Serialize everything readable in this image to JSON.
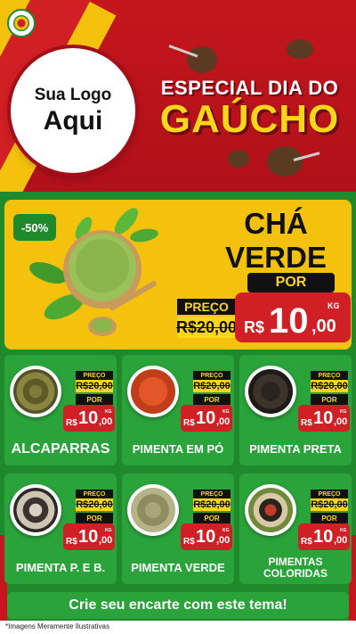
{
  "header": {
    "logo_line1": "Sua Logo",
    "logo_line2": "Aqui",
    "title_line1": "ESPECIAL DIA DO",
    "title_line2": "GAÚCHO"
  },
  "featured": {
    "discount": "-50%",
    "name_line1": "CHÁ",
    "name_line2": "VERDE",
    "por_label": "POR",
    "preco_label": "PREÇO",
    "old_price": "R$20,00",
    "currency": "R$",
    "price_int": "10",
    "price_dec": ",00",
    "unit": "KG"
  },
  "labels": {
    "preco": "PREÇO",
    "por": "POR",
    "currency": "R$",
    "unit": "KG"
  },
  "products": [
    {
      "name": "ALCAPARRAS",
      "old_price": "R$20,00",
      "price_int": "10",
      "price_dec": ",00"
    },
    {
      "name": "PIMENTA EM PÓ",
      "old_price": "R$20,00",
      "price_int": "10",
      "price_dec": ",00"
    },
    {
      "name": "PIMENTA PRETA",
      "old_price": "R$20,00",
      "price_int": "10",
      "price_dec": ",00"
    },
    {
      "name": "PIMENTA P. E B.",
      "old_price": "R$20,00",
      "price_int": "10",
      "price_dec": ",00"
    },
    {
      "name": "PIMENTA VERDE",
      "old_price": "R$20,00",
      "price_int": "10",
      "price_dec": ",00"
    },
    {
      "name": "PIMENTAS COLORIDAS",
      "old_price": "R$20,00",
      "price_int": "10",
      "price_dec": ",00"
    }
  ],
  "footer": {
    "cta": "Crie seu encarte com este tema!",
    "note": "*Imagens Meramente Ilustrativas"
  },
  "colors": {
    "red": "#c4161c",
    "green": "#1f8a2b",
    "yellow": "#f4c20d"
  }
}
